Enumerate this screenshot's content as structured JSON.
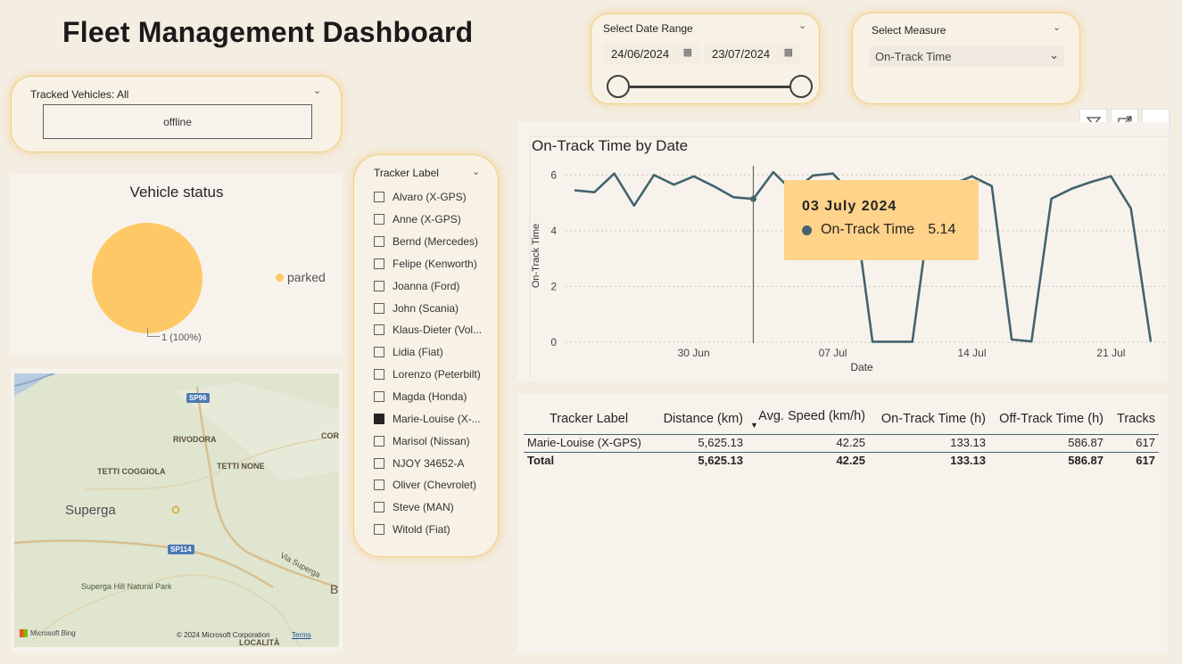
{
  "header": {
    "title": "Fleet Management Dashboard"
  },
  "tracked_vehicles": {
    "label": "Tracked Vehicles: All",
    "value": "offline"
  },
  "date_range": {
    "label": "Select Date Range",
    "start": "24/06/2024",
    "end": "23/07/2024"
  },
  "measure": {
    "label": "Select Measure",
    "value": "On-Track Time"
  },
  "vehicle_status": {
    "title": "Vehicle status",
    "legend": "parked",
    "slice_label": "1 (100%)",
    "color": "#ffc866"
  },
  "map": {
    "labels": {
      "rivodora": "RIVODORA",
      "tetti_coggiola": "TETTI COGGIOLA",
      "tetti_none": "TETTI NONE",
      "superga": "Superga",
      "superga_park": "Superga Hill Natural Park",
      "via_superga": "Via Superga",
      "localita": "LOCALITÀ",
      "cor": "COR",
      "b": "B",
      "sp96": "SP96",
      "sp114": "SP114"
    },
    "attribution": "Microsoft Bing",
    "copyright": "© 2024 Microsoft Corporation",
    "terms": "Terms"
  },
  "tracker_slicer": {
    "header": "Tracker Label",
    "items": [
      {
        "label": "Alvaro (X-GPS)",
        "checked": false
      },
      {
        "label": "Anne (X-GPS)",
        "checked": false
      },
      {
        "label": "Bernd (Mercedes)",
        "checked": false
      },
      {
        "label": "Felipe (Kenworth)",
        "checked": false
      },
      {
        "label": "Joanna (Ford)",
        "checked": false
      },
      {
        "label": "John (Scania)",
        "checked": false
      },
      {
        "label": "Klaus-Dieter (Vol...",
        "checked": false
      },
      {
        "label": "Lidia (Fiat)",
        "checked": false
      },
      {
        "label": "Lorenzo (Peterbilt)",
        "checked": false
      },
      {
        "label": "Magda (Honda)",
        "checked": false
      },
      {
        "label": "Marie-Louise (X-...",
        "checked": true
      },
      {
        "label": "Marisol (Nissan)",
        "checked": false
      },
      {
        "label": "NJOY 34652-A",
        "checked": false
      },
      {
        "label": "Oliver (Chevrolet)",
        "checked": false
      },
      {
        "label": "Steve (MAN)",
        "checked": false
      },
      {
        "label": "Witold (Fiat)",
        "checked": false
      }
    ]
  },
  "visual_header_icons": [
    "filter-icon",
    "focus-mode-icon",
    "more-options-icon"
  ],
  "chart_data": {
    "type": "line",
    "title": "On-Track Time by Date",
    "xlabel": "Date",
    "ylabel": "On-Track Time",
    "x": [
      "2024-06-24",
      "2024-06-25",
      "2024-06-26",
      "2024-06-27",
      "2024-06-28",
      "2024-06-29",
      "2024-06-30",
      "2024-07-01",
      "2024-07-02",
      "2024-07-03",
      "2024-07-04",
      "2024-07-05",
      "2024-07-06",
      "2024-07-07",
      "2024-07-08",
      "2024-07-09",
      "2024-07-10",
      "2024-07-11",
      "2024-07-12",
      "2024-07-13",
      "2024-07-14",
      "2024-07-15",
      "2024-07-16",
      "2024-07-17",
      "2024-07-18",
      "2024-07-19",
      "2024-07-20",
      "2024-07-21",
      "2024-07-22",
      "2024-07-23"
    ],
    "series": [
      {
        "name": "On-Track Time",
        "color": "#44636e",
        "values": [
          5.45,
          5.38,
          6.05,
          4.9,
          6.0,
          5.65,
          5.95,
          5.6,
          5.2,
          5.14,
          6.1,
          5.4,
          5.98,
          6.05,
          5.3,
          0.02,
          0.02,
          0.02,
          5.3,
          5.65,
          5.95,
          5.6,
          0.1,
          0.03,
          5.15,
          5.5,
          5.75,
          5.95,
          4.8,
          0.02
        ]
      }
    ],
    "xticks": [
      "30 Jun",
      "07 Jul",
      "14 Jul",
      "21 Jul"
    ],
    "yticks": [
      0,
      2,
      4,
      6
    ],
    "ylim": [
      0,
      6.2
    ],
    "grid": true,
    "hover_index": 9
  },
  "tooltip": {
    "date": "03 July 2024",
    "series": "On-Track Time",
    "value": "5.14"
  },
  "table": {
    "headers": [
      "Tracker Label",
      "Distance (km)",
      "Avg. Speed (km/h)",
      "On-Track Time (h)",
      "Off-Track Time (h)",
      "Tracks"
    ],
    "rows": [
      [
        "Marie-Louise (X-GPS)",
        "5,625.13",
        "42.25",
        "133.13",
        "586.87",
        "617"
      ]
    ],
    "total": [
      "Total",
      "5,625.13",
      "42.25",
      "133.13",
      "586.87",
      "617"
    ]
  }
}
